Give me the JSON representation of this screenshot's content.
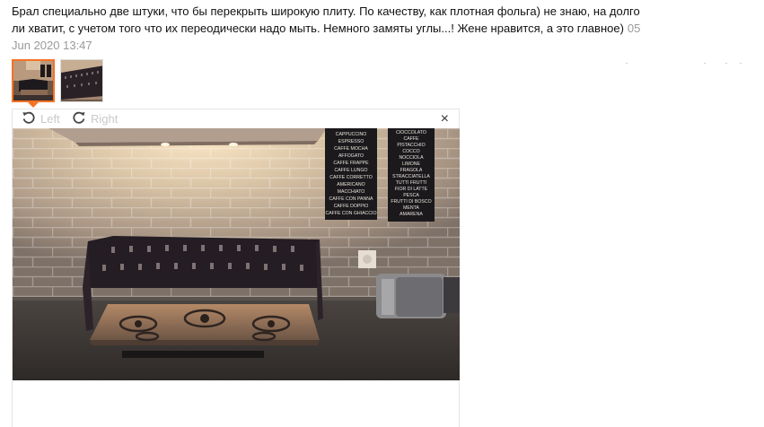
{
  "review": {
    "text": "Брал специально две штуки, что бы перекрыть широкую плиту. По качеству, как плотная фольга) не знаю, на долго ли хватит, с учетом того что их переодически надо мыть. Немного замяты углы...! Жене нравится, а это главное)",
    "date": "05 Jun 2020 13:47"
  },
  "thumbnails": [
    {
      "name": "photo-1",
      "selected": true
    },
    {
      "name": "photo-2",
      "selected": false
    }
  ],
  "viewer": {
    "rotate_left_label": "Left",
    "rotate_right_label": "Right",
    "close_label": "×"
  },
  "menu_boards": {
    "left": [
      "CAPPUCCINO",
      "ESPRESSO",
      "CAFFE MOCHA",
      "AFFOGATO",
      "CAFFE FRAPPE",
      "CAFFE LUNGO",
      "CAFFE CORRETTO",
      "AMERICANO",
      "MACCHIATO",
      "CAFFE CON PANNA",
      "CAFFE DOPPIO",
      "CAFFE CON GHIACCIO"
    ],
    "right": [
      "CIOCCOLATO",
      "CAFFE",
      "PISTACCHIO",
      "COCCO",
      "NOCCIOLA",
      "LIMONE",
      "FRAGOLA",
      "STRACCIATELLA",
      "TUTTI FRUTTI",
      "FIOR DI LATTE",
      "PESCA",
      "FRUTTI DI BOSCO",
      "MENTA",
      "AMARENA"
    ]
  },
  "colors": {
    "accent": "#f57224",
    "date": "#9a9a9a",
    "toolbar_text": "#c9c9c9"
  }
}
